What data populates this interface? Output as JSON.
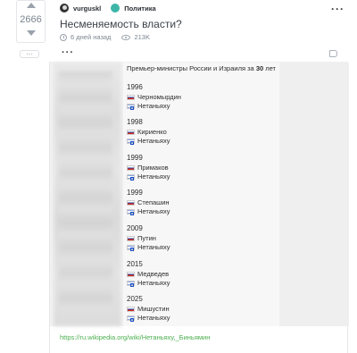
{
  "vote": {
    "count": "2666"
  },
  "post": {
    "author": "vurguskl",
    "community": "Политика",
    "title": "Несменяемость власти?",
    "time": "6 дней назад",
    "views": "213K"
  },
  "image": {
    "heading_prefix": "Премьер-министры России и Израиля за ",
    "heading_bold": "30",
    "heading_suffix": " лет",
    "entries": [
      {
        "year": "1996",
        "ru": "Черномырдин",
        "il": "Нетаньяху"
      },
      {
        "year": "1998",
        "ru": "Кириенко",
        "il": "Нетаньяху"
      },
      {
        "year": "1999",
        "ru": "Примаков",
        "il": "Нетаньяху"
      },
      {
        "year": "1999",
        "ru": "Степашин",
        "il": "Нетаньяху"
      },
      {
        "year": "2009",
        "ru": "Путин",
        "il": "Нетаньяху"
      },
      {
        "year": "2015",
        "ru": "Медведев",
        "il": "Нетаньяху"
      },
      {
        "year": "2025",
        "ru": "Мишустин",
        "il": "Нетаньяху"
      }
    ]
  },
  "source_link": "https://ru.wikipedia.org/wiki/Нетаньяху,_Биньямин",
  "icons": {
    "vote_up": "arrow-up-icon",
    "vote_down": "arrow-down-icon",
    "clock": "clock-icon",
    "views": "eye-icon",
    "tag": "tag-icon",
    "menu": "more-dots-icon"
  }
}
